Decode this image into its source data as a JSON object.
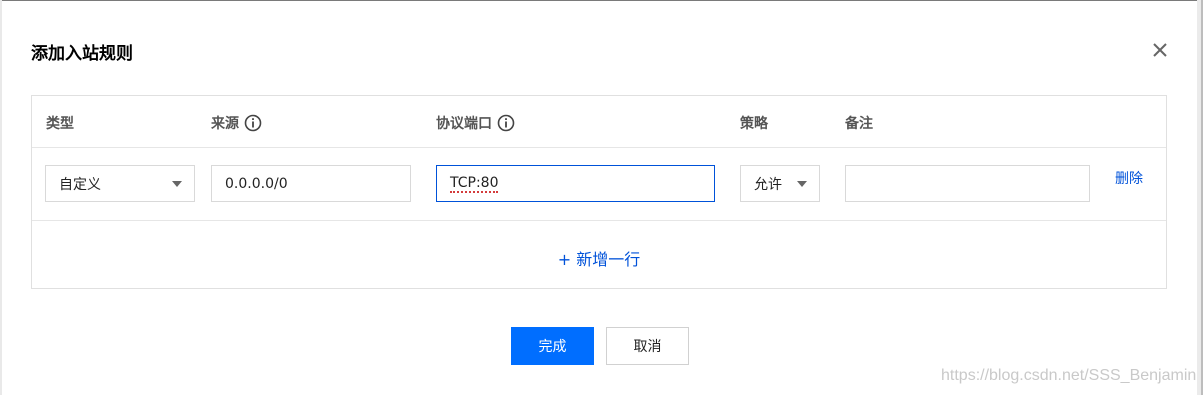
{
  "dialog": {
    "title": "添加入站规则",
    "close_icon": "close-icon"
  },
  "table": {
    "headers": {
      "type": "类型",
      "source": "来源",
      "protocol_port": "协议端口",
      "policy": "策略",
      "remark": "备注"
    },
    "row": {
      "type_value": "自定义",
      "source_value": "0.0.0.0/0",
      "protocol_port_value": "TCP:80",
      "policy_value": "允许",
      "remark_value": "",
      "delete_label": "删除"
    },
    "add_row_label": "+ 新增一行"
  },
  "footer": {
    "confirm_label": "完成",
    "cancel_label": "取消"
  },
  "watermark": "https://blog.csdn.net/SSS_Benjamin",
  "colors": {
    "primary": "#006eff",
    "link": "#0052d9"
  }
}
